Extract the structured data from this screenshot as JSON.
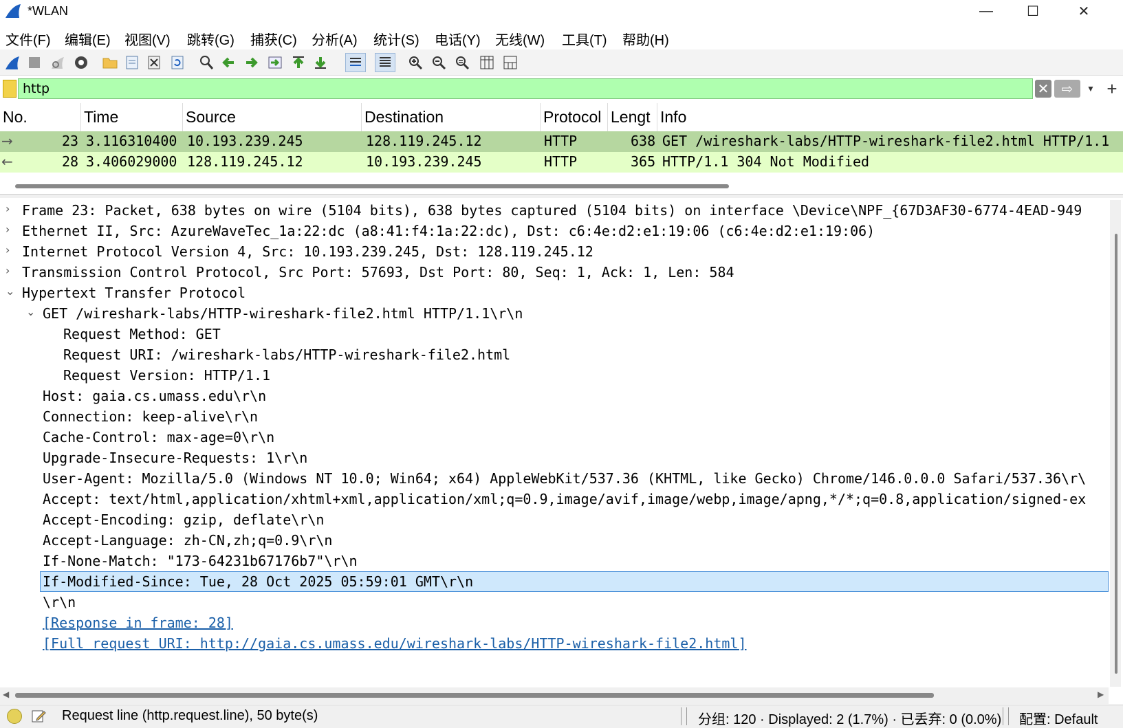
{
  "window": {
    "title": "*WLAN",
    "min_glyph": "—",
    "max_glyph": "☐",
    "close_glyph": "✕"
  },
  "menu": [
    "文件(F)",
    "编辑(E)",
    "视图(V)",
    "跳转(G)",
    "捕获(C)",
    "分析(A)",
    "统计(S)",
    "电话(Y)",
    "无线(W)",
    "工具(T)",
    "帮助(H)"
  ],
  "toolbar": {
    "icons": [
      "start-capture-icon",
      "stop-capture-icon",
      "restart-capture-icon",
      "capture-options-icon",
      "open-file-icon",
      "save-file-icon",
      "close-file-icon",
      "reload-file-icon",
      "find-packet-icon",
      "go-back-icon",
      "go-forward-icon",
      "go-to-packet-icon",
      "go-first-icon",
      "go-last-icon",
      "auto-scroll-icon",
      "colorize-icon",
      "zoom-in-icon",
      "zoom-out-icon",
      "zoom-normal-icon",
      "resize-columns-icon",
      "layout-icon"
    ]
  },
  "filter": {
    "value": "http",
    "clear_glyph": "✕",
    "apply_glyph": "⇨",
    "dropdown_glyph": "▼",
    "add_glyph": "+"
  },
  "packet_list": {
    "columns": [
      "No.",
      "Time",
      "Source",
      "Destination",
      "Protocol",
      "Lengt",
      "Info"
    ],
    "rows": [
      {
        "no": "23",
        "time": "3.116310400",
        "src": "10.193.239.245",
        "dst": "128.119.245.12",
        "proto": "HTTP",
        "len": "638",
        "info": "GET /wireshark-labs/HTTP-wireshark-file2.html HTTP/1.1",
        "dir": "→"
      },
      {
        "no": "28",
        "time": "3.406029000",
        "src": "128.119.245.12",
        "dst": "10.193.239.245",
        "proto": "HTTP",
        "len": "365",
        "info": "HTTP/1.1 304 Not Modified",
        "dir": "←"
      }
    ]
  },
  "details": [
    {
      "arrow": "›",
      "text": "Frame 23: Packet, 638 bytes on wire (5104 bits), 638 bytes captured (5104 bits) on interface \\Device\\NPF_{67D3AF30-6774-4EAD-949"
    },
    {
      "arrow": "›",
      "text": "Ethernet II, Src: AzureWaveTec_1a:22:dc (a8:41:f4:1a:22:dc), Dst: c6:4e:d2:e1:19:06 (c6:4e:d2:e1:19:06)"
    },
    {
      "arrow": "›",
      "text": "Internet Protocol Version 4, Src: 10.193.239.245, Dst: 128.119.245.12"
    },
    {
      "arrow": "›",
      "text": "Transmission Control Protocol, Src Port: 57693, Dst Port: 80, Seq: 1, Ack: 1, Len: 584"
    },
    {
      "arrow": "⌄",
      "text": "Hypertext Transfer Protocol"
    },
    {
      "arrow": "⌄",
      "text": "GET /wireshark-labs/HTTP-wireshark-file2.html HTTP/1.1\\r\\n"
    },
    {
      "arrow": "",
      "text": "Request Method: GET"
    },
    {
      "arrow": "",
      "text": "Request URI: /wireshark-labs/HTTP-wireshark-file2.html"
    },
    {
      "arrow": "",
      "text": "Request Version: HTTP/1.1"
    },
    {
      "arrow": "",
      "text": "Host: gaia.cs.umass.edu\\r\\n"
    },
    {
      "arrow": "",
      "text": "Connection: keep-alive\\r\\n"
    },
    {
      "arrow": "",
      "text": "Cache-Control: max-age=0\\r\\n"
    },
    {
      "arrow": "",
      "text": "Upgrade-Insecure-Requests: 1\\r\\n"
    },
    {
      "arrow": "",
      "text": "User-Agent: Mozilla/5.0 (Windows NT 10.0; Win64; x64) AppleWebKit/537.36 (KHTML, like Gecko) Chrome/146.0.0.0 Safari/537.36\\r\\"
    },
    {
      "arrow": "",
      "text": "Accept: text/html,application/xhtml+xml,application/xml;q=0.9,image/avif,image/webp,image/apng,*/*;q=0.8,application/signed-ex"
    },
    {
      "arrow": "",
      "text": "Accept-Encoding: gzip, deflate\\r\\n"
    },
    {
      "arrow": "",
      "text": "Accept-Language: zh-CN,zh;q=0.9\\r\\n"
    },
    {
      "arrow": "",
      "text": "If-None-Match: \"173-64231b67176b7\"\\r\\n"
    },
    {
      "arrow": "",
      "text": "If-Modified-Since: Tue, 28 Oct 2025 05:59:01 GMT\\r\\n"
    },
    {
      "arrow": "",
      "text": "\\r\\n"
    },
    {
      "arrow": "",
      "text": "[Response in frame: 28]"
    },
    {
      "arrow": "",
      "text": "[Full request URI: http://gaia.cs.umass.edu/wireshark-labs/HTTP-wireshark-file2.html]"
    }
  ],
  "status": {
    "text": "Request line (http.request.line), 50 byte(s)",
    "stats": "分组: 120 · Displayed: 2 (1.7%) · 已丢弃: 0 (0.0%)",
    "profile": "配置: Default"
  },
  "colors": {
    "filter_valid": "#afffaf",
    "row_selected": "#b6d7a0",
    "row_http": "#e4ffc7",
    "detail_selected": "#cfe8fc",
    "link": "#1a5fa8"
  }
}
